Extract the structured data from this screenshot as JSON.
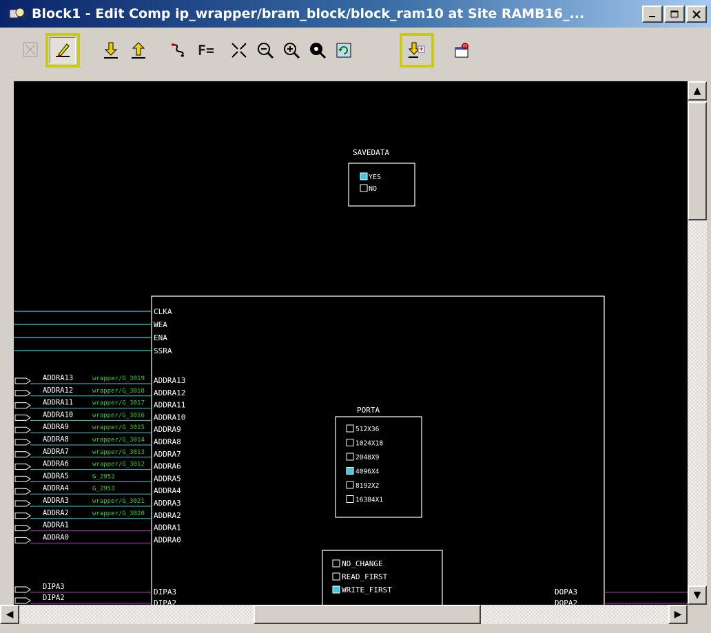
{
  "window": {
    "title": "Block1 - Edit Comp ip_wrapper/bram_block/block_ram10 at Site RAMB16_...",
    "app_icon": "fpga-editor-icon",
    "buttons": [
      "minimize",
      "maximize",
      "close"
    ]
  },
  "toolbar": {
    "buttons": [
      {
        "name": "pin-icon",
        "state": "disabled"
      },
      {
        "name": "edit-mode-pencil-icon",
        "state": "pressed",
        "highlighted": true
      },
      {
        "name": "download-arrow-icon"
      },
      {
        "name": "upload-arrow-icon"
      },
      {
        "name": "route-icon"
      },
      {
        "name": "f-equals-icon",
        "label": "F="
      },
      {
        "name": "zoom-fit-icon"
      },
      {
        "name": "zoom-out-icon"
      },
      {
        "name": "zoom-in-icon"
      },
      {
        "name": "zoom-selected-icon"
      },
      {
        "name": "refresh-icon"
      },
      {
        "name": "save-apply-icon",
        "highlighted": true
      },
      {
        "name": "properties-icon"
      }
    ],
    "highlight_color": "#c9c91a"
  },
  "canvas": {
    "background": "#000000",
    "wire_color": "#40c8d0",
    "net_color": "#30d030",
    "alt_wire_color": "#c030c0",
    "savedata": {
      "title": "SAVEDATA",
      "options": [
        {
          "label": "YES",
          "checked": true
        },
        {
          "label": "NO",
          "checked": false
        }
      ]
    },
    "porta": {
      "title": "PORTA",
      "options": [
        {
          "label": "512X36",
          "checked": false
        },
        {
          "label": "1024X18",
          "checked": false
        },
        {
          "label": "2048X9",
          "checked": false
        },
        {
          "label": "4096X4",
          "checked": true
        },
        {
          "label": "8192X2",
          "checked": false
        },
        {
          "label": "16384X1",
          "checked": false
        }
      ]
    },
    "write_mode": {
      "options": [
        {
          "label": "NO_CHANGE",
          "checked": false
        },
        {
          "label": "READ_FIRST",
          "checked": false
        },
        {
          "label": "WRITE_FIRST",
          "checked": true
        }
      ]
    },
    "clock_pins": [
      "CLKA",
      "WEA",
      "ENA",
      "SSRA"
    ],
    "addr_rows": [
      {
        "ext": "ADDRA13",
        "net": "wrapper/G_3019",
        "pin": "ADDRA13"
      },
      {
        "ext": "ADDRA12",
        "net": "wrapper/G_3018",
        "pin": "ADDRA12"
      },
      {
        "ext": "ADDRA11",
        "net": "wrapper/G_3017",
        "pin": "ADDRA11"
      },
      {
        "ext": "ADDRA10",
        "net": "wrapper/G_3016",
        "pin": "ADDRA10"
      },
      {
        "ext": "ADDRA9",
        "net": "wrapper/G_3015",
        "pin": "ADDRA9"
      },
      {
        "ext": "ADDRA8",
        "net": "wrapper/G_3014",
        "pin": "ADDRA8"
      },
      {
        "ext": "ADDRA7",
        "net": "wrapper/G_3013",
        "pin": "ADDRA7"
      },
      {
        "ext": "ADDRA6",
        "net": "wrapper/G_3012",
        "pin": "ADDRA6"
      },
      {
        "ext": "ADDRA5",
        "net": "G_2952",
        "pin": "ADDRA5"
      },
      {
        "ext": "ADDRA4",
        "net": "G_2953",
        "pin": "ADDRA4"
      },
      {
        "ext": "ADDRA3",
        "net": "wrapper/G_3021",
        "pin": "ADDRA3"
      },
      {
        "ext": "ADDRA2",
        "net": "wrapper/G_3020",
        "pin": "ADDRA2"
      },
      {
        "ext": "ADDRA1",
        "net": "",
        "pin": "ADDRA1"
      },
      {
        "ext": "ADDRA0",
        "net": "",
        "pin": "ADDRA0"
      }
    ],
    "data_rows": [
      {
        "ext": "DIPA3",
        "pin": "DIPA3",
        "out": "DOPA3"
      },
      {
        "ext": "DIPA2",
        "pin": "DIPA2",
        "out": "DOPA2"
      }
    ]
  },
  "scrollbars": {
    "vertical": {
      "up": "▲",
      "down": "▼"
    },
    "horizontal": {
      "left": "◀",
      "right": "▶"
    }
  }
}
